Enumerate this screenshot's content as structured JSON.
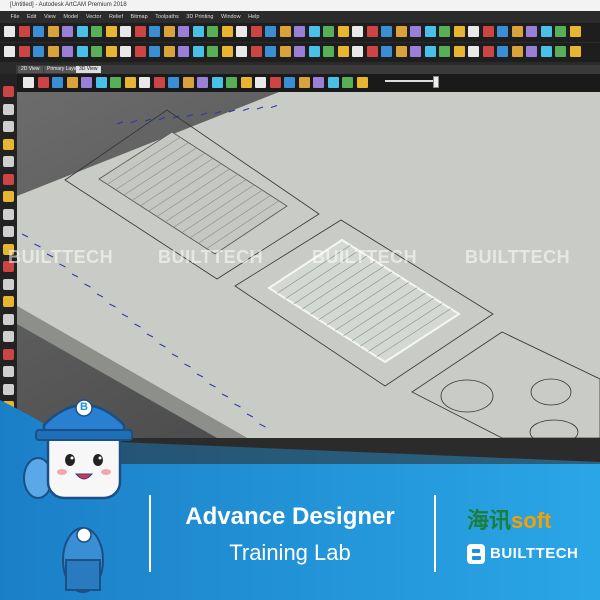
{
  "window": {
    "title": "[Untitled] - Autodesk ArtCAM Premium 2018"
  },
  "menu": [
    "File",
    "Edit",
    "View",
    "Model",
    "Vector",
    "Relief",
    "Bitmap",
    "Toolpaths",
    "3D Printing",
    "Window",
    "Help"
  ],
  "tabs": [
    {
      "label": "2D View"
    },
    {
      "label": "Primary Layer"
    },
    {
      "label": "3D View"
    }
  ],
  "palette": [
    "#cc2222",
    "#ff33cc",
    "#ffffcc",
    "#ffff88",
    "#ddaa22"
  ],
  "watermarks": [
    "BUILTTECH",
    "BUILTTECH",
    "BUILTTECH",
    "BUILTTECH"
  ],
  "banner": {
    "line1": "Advance Designer",
    "line2": "Training Lab",
    "brand_cn": "海讯",
    "brand_soft": "soft",
    "brand_built": "BUILTTECH",
    "colors": {
      "blue": "#1f8fd8",
      "green": "#1a7f3a",
      "orange": "#f5a000"
    }
  },
  "mascot": {
    "badge": "B"
  }
}
